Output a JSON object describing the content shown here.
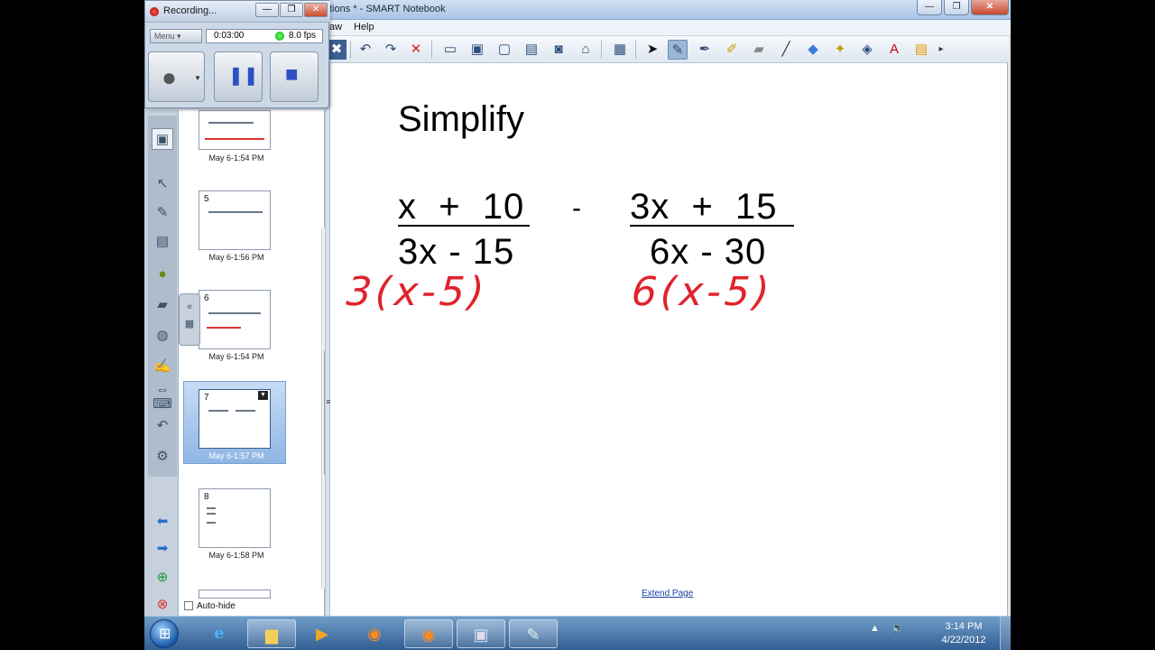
{
  "window": {
    "title": "tions * - SMART Notebook",
    "min": "—",
    "max": "❐",
    "close": "✕"
  },
  "menu": {
    "draw": "aw",
    "help": "Help"
  },
  "recorder": {
    "title": "Recording...",
    "menu_label": "Menu",
    "elapsed": "0:03:00",
    "fps": "8.0 fps",
    "min": "—",
    "restore": "❐",
    "close": "✕",
    "record_symbol": "●",
    "pause_symbol": "❚❚",
    "stop_symbol": "■"
  },
  "sorter": {
    "pages": [
      {
        "number": "",
        "caption": "May 6-1:54 PM"
      },
      {
        "number": "5",
        "caption": "May 6-1:56 PM"
      },
      {
        "number": "6",
        "caption": "May 6-1:54 PM"
      },
      {
        "number": "7",
        "caption": "May 6-1:57 PM",
        "selected": true
      },
      {
        "number": "8",
        "caption": "May 6-1:58 PM"
      }
    ],
    "autohide_label": "Auto-hide"
  },
  "canvas": {
    "heading": "Simplify",
    "fraction1": {
      "numerator": "x  +  10",
      "denominator": "3x - 15"
    },
    "operator": "-",
    "fraction2": {
      "numerator": "3x  +  15",
      "denominator": "6x - 30"
    },
    "ink1": "3(x-5)",
    "ink2": "6(x-5)",
    "extend_link": "Extend Page"
  },
  "taskbar": {
    "clock_time": "3:14 PM",
    "clock_date": "4/22/2012"
  },
  "colors": {
    "ink": "#e0232c",
    "accent": "#2d4fc4"
  }
}
